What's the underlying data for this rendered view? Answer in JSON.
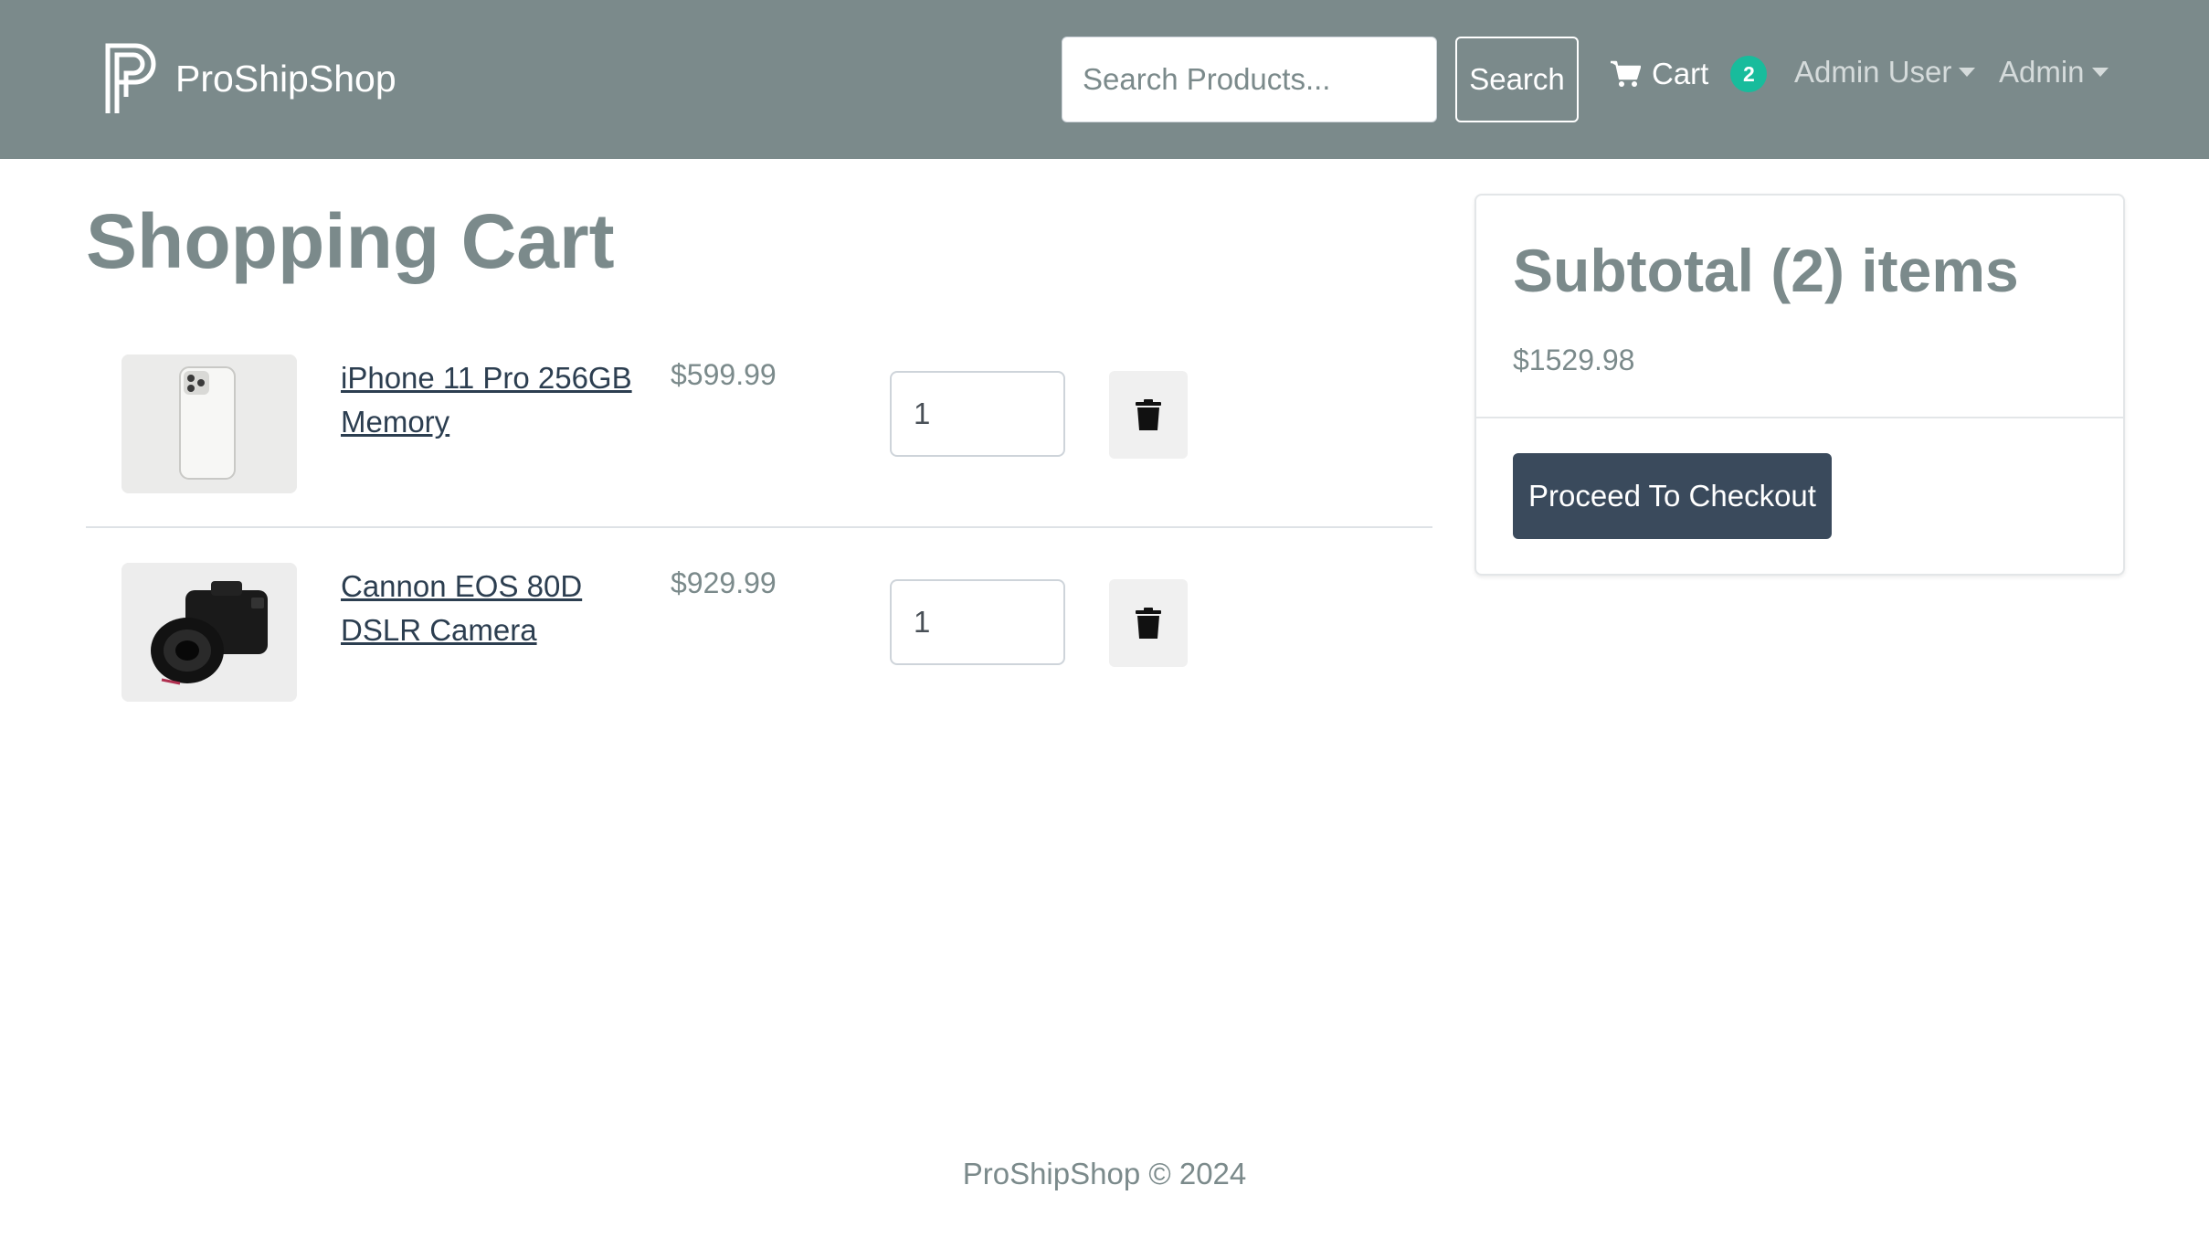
{
  "navbar": {
    "brand_name": "ProShipShop",
    "search": {
      "placeholder": "Search Products...",
      "value": "",
      "button_label": "Search"
    },
    "cart": {
      "label": "Cart",
      "count": "2"
    },
    "user_menu_label": "Admin User",
    "admin_menu_label": "Admin"
  },
  "main": {
    "title": "Shopping Cart",
    "items": [
      {
        "name": "iPhone 11 Pro 256GB Memory",
        "price": "$599.99",
        "qty": "1",
        "image_icon": "phone-image"
      },
      {
        "name": "Cannon EOS 80D DSLR Camera",
        "price": "$929.99",
        "qty": "1",
        "image_icon": "camera-image"
      }
    ]
  },
  "summary": {
    "title": "Subtotal (2) items",
    "amount": "$1529.98",
    "checkout_label": "Proceed To Checkout"
  },
  "footer": {
    "text": "ProShipShop © 2024"
  },
  "colors": {
    "navbar": "#7b8a8b",
    "badge": "#18bc9c",
    "checkout_button": "#3a4a5c",
    "link": "#2c3e50",
    "muted_text": "#7b8a8b"
  }
}
